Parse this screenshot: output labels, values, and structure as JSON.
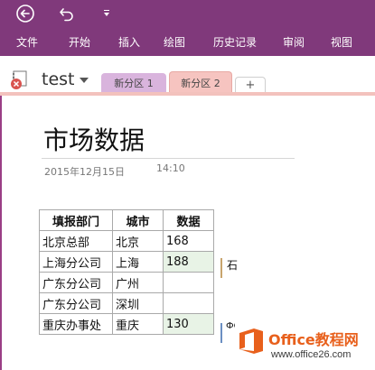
{
  "ribbon": {
    "tabs": [
      "文件",
      "开始",
      "插入",
      "绘图",
      "历史记录",
      "审阅",
      "视图"
    ]
  },
  "notebook": {
    "name": "test",
    "sections": [
      "新分区 1",
      "新分区 2"
    ],
    "add_label": "+"
  },
  "page": {
    "title": "市场数据",
    "date": "2015年12月15日",
    "time": "14:10"
  },
  "table": {
    "headers": [
      "填报部门",
      "城市",
      "数据"
    ],
    "rows": [
      [
        "北京总部",
        "北京",
        "168"
      ],
      [
        "上海分公司",
        "上海",
        "188"
      ],
      [
        "广东分公司",
        "广州",
        ""
      ],
      [
        "广东分公司",
        "深圳",
        ""
      ],
      [
        "重庆办事处",
        "重庆",
        "130"
      ]
    ]
  },
  "side_notes": {
    "note1": "石",
    "note2": "ФС"
  },
  "watermark": {
    "brand": "Office教程网",
    "url": "www.office26.com"
  },
  "colors": {
    "ribbon": "#80397b",
    "section1": "#d9b4dd",
    "section2": "#f6c4c0",
    "highlight": "#e8f3e6",
    "brand": "#e8601c"
  }
}
